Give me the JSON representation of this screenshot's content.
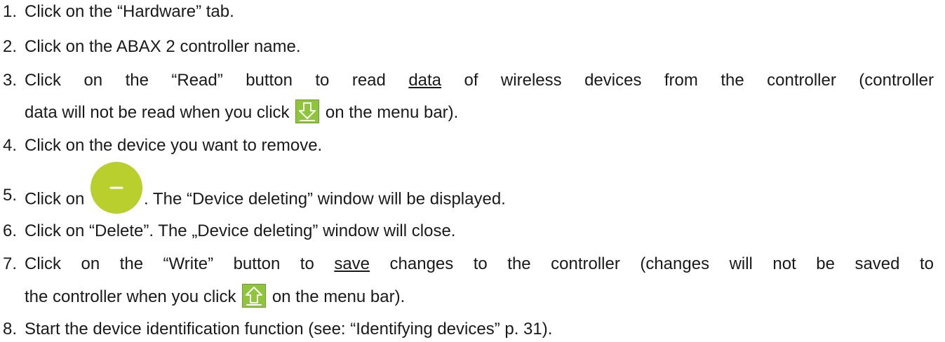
{
  "steps": [
    {
      "num": "1.",
      "text": "Click on the “Hardware” tab."
    },
    {
      "num": "2.",
      "text": "Click on the ABAX 2 controller name."
    },
    {
      "num": "3.",
      "text_a": "Click on the “Read” button to read ",
      "text_ul": "data",
      "text_b": " of wireless devices from the controller (controller",
      "cont_a": "data will not be read when you click",
      "cont_b": " on the menu bar).",
      "icon": "download-arrow-icon"
    },
    {
      "num": "4.",
      "text": "Click on the device you want to remove."
    },
    {
      "num": "5.",
      "text_a": "Click on ",
      "text_b": ". The “Device deleting” window will be displayed.",
      "icon": "minus-circle-icon"
    },
    {
      "num": "6.",
      "text": "Click on “Delete”. The „Device deleting” window will close."
    },
    {
      "num": "7.",
      "text_a": "Click on the “Write” button to ",
      "text_ul": "save",
      "text_b": " changes to the controller (changes will not be saved to",
      "cont_a": "the controller when you click",
      "cont_b": " on the menu bar).",
      "icon": "upload-arrow-icon"
    },
    {
      "num": "8.",
      "text": "Start the device identification function (see: “Identifying devices” p. 31)."
    }
  ],
  "colors": {
    "icon_green": "#8fc53a",
    "minus_green": "#b9cf2e",
    "text": "#1a1a1a"
  }
}
